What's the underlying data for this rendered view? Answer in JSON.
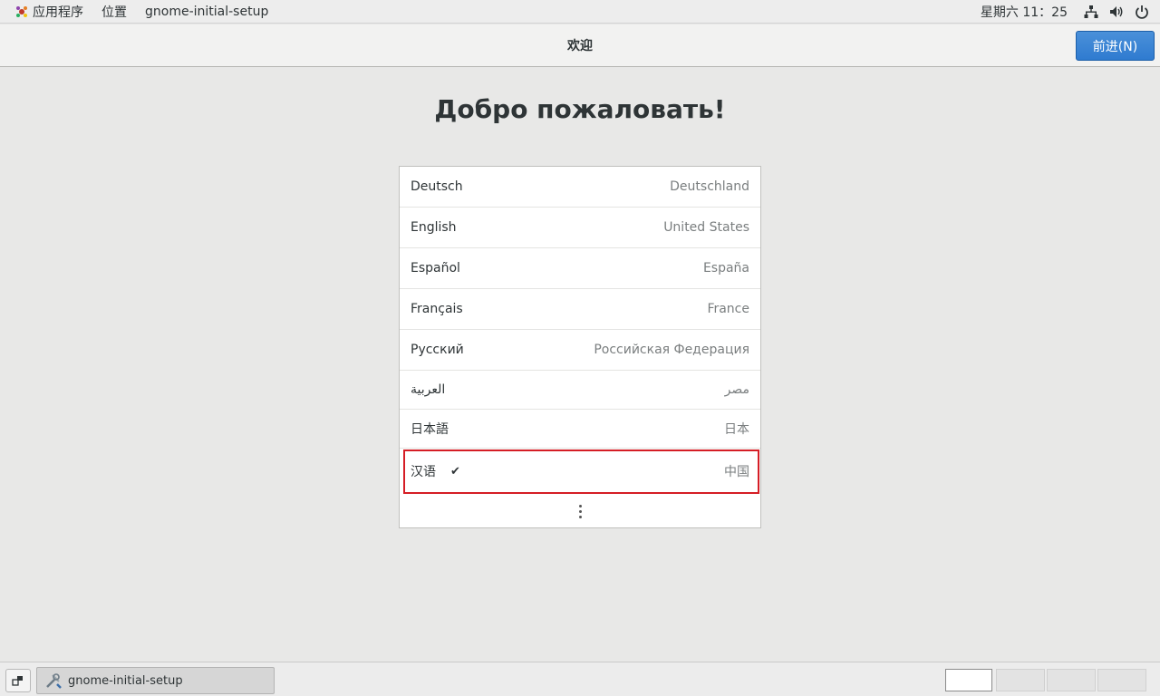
{
  "top_panel": {
    "applications": "应用程序",
    "places": "位置",
    "app_name": "gnome-initial-setup",
    "clock": "星期六 11：25",
    "icons": [
      "network-icon",
      "volume-icon",
      "power-icon"
    ]
  },
  "header": {
    "title": "欢迎",
    "next_button": "前进(N)"
  },
  "main": {
    "welcome_title": "Добро пожаловать!",
    "languages": [
      {
        "name": "Deutsch",
        "region": "Deutschland"
      },
      {
        "name": "English",
        "region": "United States"
      },
      {
        "name": "Español",
        "region": "España"
      },
      {
        "name": "Français",
        "region": "France"
      },
      {
        "name": "Русский",
        "region": "Российская Федерация"
      },
      {
        "name": "العربية",
        "region": "مصر"
      },
      {
        "name": "日本語",
        "region": "日本"
      },
      {
        "name": "汉语",
        "region": "中国",
        "selected": true
      }
    ],
    "check_mark": "✔",
    "more_icon": "vertical-ellipsis-icon"
  },
  "bottom_panel": {
    "task_label": "gnome-initial-setup",
    "workspaces": 4,
    "active_workspace": 1
  },
  "colors": {
    "accent": "#3584e4",
    "selection_outline": "#d51d25",
    "background": "#e8e8e7"
  }
}
